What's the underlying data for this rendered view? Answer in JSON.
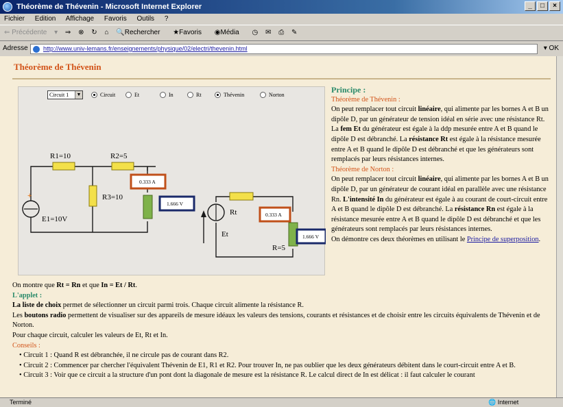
{
  "window": {
    "title": "Théorème de Thévenin - Microsoft Internet Explorer"
  },
  "menu": [
    "Fichier",
    "Edition",
    "Affichage",
    "Favoris",
    "Outils",
    "?"
  ],
  "toolbar": {
    "back": "Précédente",
    "search": "Rechercher",
    "favorites": "Favoris",
    "media": "Média"
  },
  "address": {
    "label": "Adresse",
    "url": "http://www.univ-lemans.fr/enseignements/physique/02/electri/thevenin.html",
    "go": "OK"
  },
  "status": {
    "text": "Terminé",
    "zone": "Internet"
  },
  "page": {
    "title": "Théorème de Thévenin",
    "applet": {
      "select_value": "Circuit 1",
      "radios": [
        "Circuit",
        "Et",
        "In",
        "Rt",
        "Thévenin",
        "Norton"
      ],
      "selected": [
        "Circuit",
        "Thévenin"
      ],
      "labels": {
        "r1": "R1=10",
        "r2": "R2=5",
        "r3": "R3=10",
        "e1": "E1=10V",
        "rt": "Rt",
        "et": "Et",
        "r": "R=5"
      },
      "meters": {
        "a1": "0.333 A",
        "v1": "1.666 V",
        "a2": "0.333 A",
        "v2": "1.666 V"
      }
    },
    "principe": {
      "heading": "Principe :",
      "thevenin_title": "Théorème de Thévenin :",
      "thevenin_p1": "On peut remplacer tout circuit ",
      "thevenin_b1": "linéaire",
      "thevenin_p2": ", qui alimente par les bornes A et B un dipôle D, par un générateur de tension idéal en série avec une résistance Rt. La ",
      "thevenin_b2": "fem Et",
      "thevenin_p3": " du générateur est égale à la ddp mesurée entre A et B quand le dipôle D est débranché. La ",
      "thevenin_b3": "résistance Rt",
      "thevenin_p4": " est égale à la résistance mesurée entre A et B quand le dipôle D est débranché et que les générateurs sont remplacés par leurs résistances internes.",
      "norton_title": "Théorème de Norton :",
      "norton_p1": "On peut remplacer tout circuit ",
      "norton_b1": "linéaire",
      "norton_p2": ", qui alimente par les bornes A et B un dipôle D, par un générateur de courant idéal en parallèle avec une résistance Rn. ",
      "norton_b2": "L'intensité In",
      "norton_p3": " du générateur est égale à au courant de court-circuit entre A et B quand le dipôle D est débranché. La ",
      "norton_b3": "résistance Rn",
      "norton_p4": " est égale à la résistance mesurée entre A et B quand le dipôle D est débranché et que les générateurs sont remplacés par leurs résistances internes.",
      "demo_text": "On démontre ces deux théorèmes en utilisant le ",
      "demo_link": "Principe de superposition",
      "demo_end": "."
    },
    "bottom": {
      "eq_pre": "On montre que ",
      "eq1": "Rt = Rn",
      "eq_mid": " et que ",
      "eq2": "In = Et / Rt",
      "eq_end": ".",
      "applet_heading": "L'applet :",
      "p1_b": "La liste de choix",
      "p1": " permet de sélectionner un circuit parmi trois.  Chaque circuit alimente la résistance R.",
      "p2_pre": "Les ",
      "p2_b": "boutons radio",
      "p2": " permettent de visualiser sur des appareils de mesure idéaux les valeurs des tensions, courants et résistances et de choisir entre les circuits équivalents de Thévenin et de Norton.",
      "p3": "Pour chaque circuit, calculer les valeurs de Et, Rt et In.",
      "conseils": "Conseils :",
      "tips": [
        "Circuit 1 : Quand R est débranchée, il ne circule pas de courant dans R2.",
        "Circuit 2 : Commencer par chercher l'équivalent Thévenin de E1, R1 et R2. Pour trouver In, ne pas oublier que les deux générateurs débitent dans le court-circuit entre A et B.",
        "Circuit 3 : Voir que ce circuit a la structure d'un pont dont la diagonale de mesure est la résistance R. Le calcul direct de In est délicat : il faut calculer le courant"
      ]
    }
  }
}
